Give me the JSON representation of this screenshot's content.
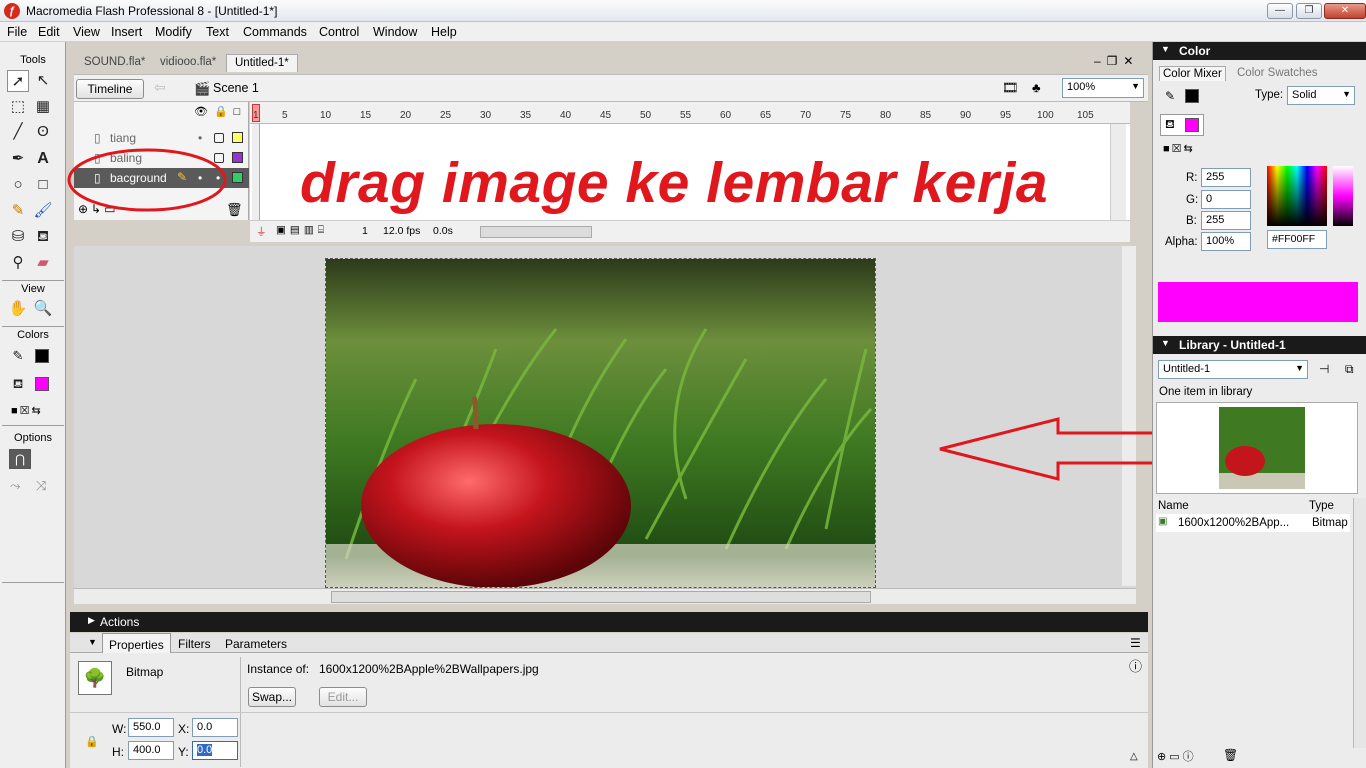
{
  "window": {
    "title": "Macromedia Flash Professional 8 - [Untitled-1*]",
    "app_icon": "flash-logo",
    "buttons": {
      "minimize": "—",
      "maximize": "❐",
      "close": "✕"
    }
  },
  "menubar": {
    "items": [
      "File",
      "Edit",
      "View",
      "Insert",
      "Modify",
      "Text",
      "Commands",
      "Control",
      "Window",
      "Help"
    ]
  },
  "tools": {
    "title": "Tools",
    "view_title": "View",
    "colors_title": "Colors",
    "options_title": "Options",
    "stroke_color": "#000000",
    "fill_color": "#ff00ff"
  },
  "documents": {
    "tabs": [
      "SOUND.fla*",
      "vidiooo.fla*",
      "Untitled-1*"
    ],
    "active_tab": "Untitled-1*"
  },
  "timeline": {
    "button_label": "Timeline",
    "scene_label": "Scene 1",
    "zoom": "100%",
    "layers": [
      {
        "name": "tiang",
        "color": "#ffff66",
        "active": false
      },
      {
        "name": "baling",
        "color": "#9933cc",
        "active": false
      },
      {
        "name": "bacground",
        "color": "#33cc66",
        "active": true
      }
    ],
    "ruler": [
      "1",
      "5",
      "10",
      "15",
      "20",
      "25",
      "30",
      "35",
      "40",
      "45",
      "50",
      "55",
      "60",
      "65",
      "70",
      "75",
      "80",
      "85",
      "90",
      "95",
      "100",
      "105"
    ],
    "current_frame": "1",
    "fps": "12.0 fps",
    "elapsed": "0.0s"
  },
  "annotation": {
    "text": "drag image ke lembar kerja"
  },
  "panels": {
    "actions_label": "Actions",
    "props_tabs": [
      "Properties",
      "Filters",
      "Parameters"
    ],
    "props": {
      "type_label": "Bitmap",
      "instance_of_label": "Instance of:",
      "instance_of_value": "1600x1200%2BApple%2BWallpapers.jpg",
      "swap_label": "Swap...",
      "edit_label": "Edit...",
      "w_label": "W:",
      "w_value": "550.0",
      "h_label": "H:",
      "h_value": "400.0",
      "x_label": "X:",
      "x_value": "0.0",
      "y_label": "Y:",
      "y_value": "0.0"
    }
  },
  "color_panel": {
    "title": "Color",
    "tabs": [
      "Color Mixer",
      "Color Swatches"
    ],
    "type_label": "Type:",
    "type_value": "Solid",
    "r_label": "R:",
    "r_value": "255",
    "g_label": "G:",
    "g_value": "0",
    "b_label": "B:",
    "b_value": "255",
    "alpha_label": "Alpha:",
    "alpha_value": "100%",
    "hex_value": "#FF00FF",
    "preview_color": "#ff00ff"
  },
  "library_panel": {
    "title": "Library - Untitled-1",
    "doc_select": "Untitled-1",
    "count_text": "One item in library",
    "col_name": "Name",
    "col_type": "Type",
    "items": [
      {
        "name": "1600x1200%2BApp...",
        "type": "Bitmap"
      }
    ]
  }
}
